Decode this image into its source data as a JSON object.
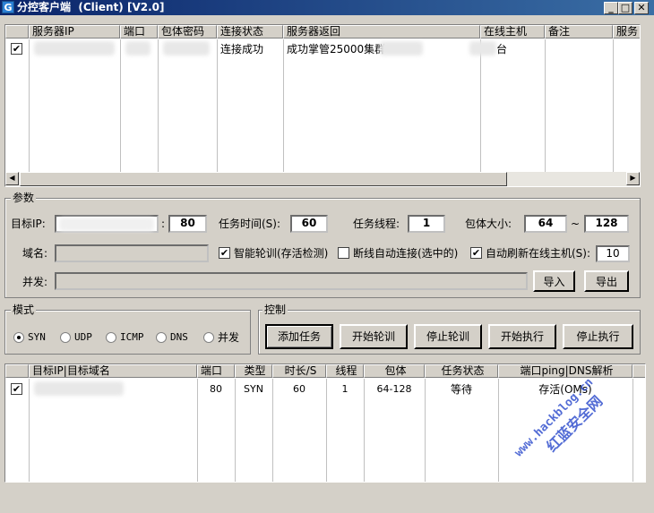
{
  "window": {
    "title": "分控客户端  (Client) [V2.0]",
    "app_icon": "G",
    "minimize": "_",
    "maximize": "□",
    "close": "✕"
  },
  "server_list": {
    "columns": [
      "服务器IP",
      "端口",
      "包体密码",
      "连接状态",
      "服务器返回",
      "在线主机",
      "备注",
      "服务"
    ],
    "rows": [
      {
        "checked": true,
        "check_glyph": "✔",
        "ip": "",
        "port": "",
        "password": "",
        "status": "连接成功",
        "response": "成功掌管25000集群",
        "online": "台",
        "note": ""
      }
    ],
    "scroll_left": "◀",
    "scroll_right": "▶"
  },
  "params": {
    "title": "参数",
    "target_ip_label": "目标IP:",
    "colon": ":",
    "port": "80",
    "task_time_label": "任务时间(S):",
    "task_time": "60",
    "threads_label": "任务线程:",
    "threads": "1",
    "packet_size_label": "包体大小:",
    "packet_min": "64",
    "tilde": "~",
    "packet_max": "128",
    "domain_label": "域名:",
    "smart_poll_label": "智能轮训(存活检测)",
    "smart_poll_checked": true,
    "auto_reconnect_label": "断线自动连接(选中的)",
    "auto_reconnect_checked": false,
    "auto_refresh_label": "自动刷新在线主机(S):",
    "auto_refresh_checked": true,
    "auto_refresh": "10",
    "concurrent_label": "并发:",
    "import_btn": "导入",
    "export_btn": "导出"
  },
  "mode": {
    "title": "模式",
    "options": [
      "SYN",
      "UDP",
      "ICMP",
      "DNS",
      "并发"
    ],
    "selected": "SYN"
  },
  "control": {
    "title": "控制",
    "buttons": [
      "添加任务",
      "开始轮训",
      "停止轮训",
      "开始执行",
      "停止执行"
    ]
  },
  "task_list": {
    "columns": [
      "目标IP|目标域名",
      "端口",
      "类型",
      "时长/S",
      "线程",
      "包体",
      "任务状态",
      "端口ping|DNS解析"
    ],
    "rows": [
      {
        "checked": true,
        "target": "",
        "port": "80",
        "type": "SYN",
        "duration": "60",
        "threads": "1",
        "packet": "64-128",
        "status": "等待",
        "ping": "存活(OMs)"
      }
    ]
  },
  "watermark": {
    "line1": "www.hackblog.cn",
    "line2": "红蓝安全网"
  }
}
